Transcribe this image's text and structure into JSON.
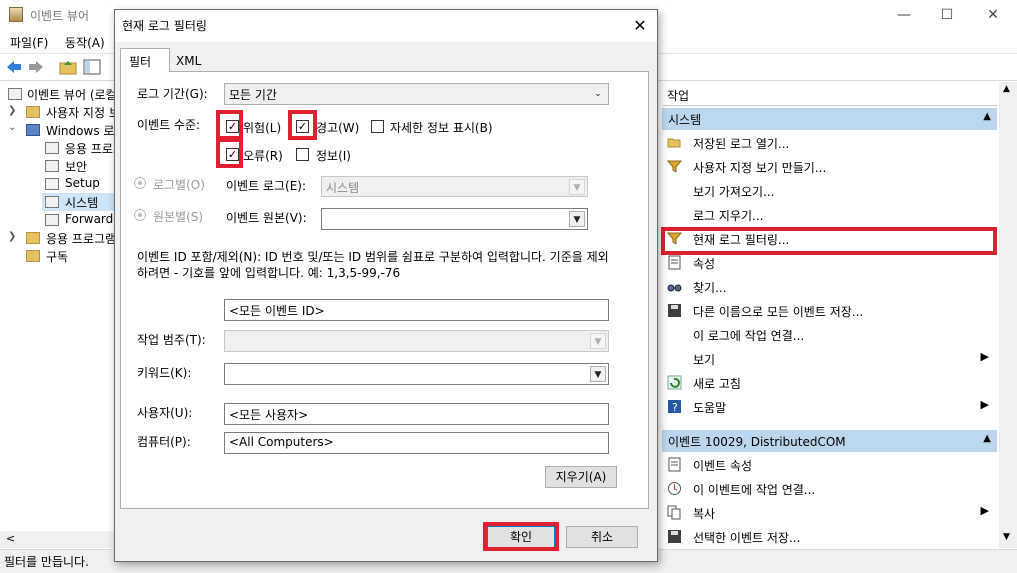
{
  "app": {
    "title": "이벤트 뷰어",
    "icon": "event-viewer-icon"
  },
  "window_controls": {
    "minimize": "—",
    "maximize": "☐",
    "close": "✕"
  },
  "menu": {
    "file": "파일(F)",
    "action": "동작(A)"
  },
  "tree": {
    "root": "이벤트 뷰어 (로컬)",
    "custom_views": "사용자 지정 보기",
    "windows_logs": "Windows 로그",
    "application": "응용 프로그램",
    "security": "보안",
    "setup": "Setup",
    "system": "시스템",
    "forwarded": "Forwarded Events",
    "apps_services": "응용 프로그램 및 서비스 로그",
    "subscriptions": "구독"
  },
  "status": {
    "text": "필터를 만듭니다."
  },
  "actions": {
    "title": "작업",
    "section1": "시스템",
    "items1": [
      {
        "label": "저장된 로그 열기...",
        "icon": "open-folder-icon"
      },
      {
        "label": "사용자 지정 보기 만들기...",
        "icon": "filter-icon"
      },
      {
        "label": "보기 가져오기...",
        "icon": ""
      },
      {
        "label": "로그 지우기...",
        "icon": ""
      },
      {
        "label": "현재 로그 필터링...",
        "icon": "filter-icon"
      },
      {
        "label": "속성",
        "icon": "properties-icon"
      },
      {
        "label": "찾기...",
        "icon": "find-icon"
      },
      {
        "label": "다른 이름으로 모든 이벤트 저장...",
        "icon": "save-icon"
      },
      {
        "label": "이 로그에 작업 연결...",
        "icon": ""
      },
      {
        "label": "보기",
        "icon": ""
      },
      {
        "label": "새로 고침",
        "icon": "refresh-icon"
      },
      {
        "label": "도움말",
        "icon": "help-icon"
      }
    ],
    "section2": "이벤트 10029, DistributedCOM",
    "items2": [
      {
        "label": "이벤트 속성",
        "icon": "properties-icon"
      },
      {
        "label": "이 이벤트에 작업 연결...",
        "icon": "task-icon"
      },
      {
        "label": "복사",
        "icon": "copy-icon"
      },
      {
        "label": "선택한 이벤트 저장...",
        "icon": "save-icon"
      }
    ]
  },
  "dialog": {
    "title": "현재 로그 필터링",
    "close": "✕",
    "tabs": {
      "filter": "필터",
      "xml": "XML"
    },
    "logged_label": "로그 기간(G):",
    "logged_value": "모든 기간",
    "level_label": "이벤트 수준:",
    "levels": {
      "critical": {
        "label": "위험(L)",
        "checked": true
      },
      "warning": {
        "label": "경고(W)",
        "checked": true
      },
      "verbose": {
        "label": "자세한 정보 표시(B)",
        "checked": false
      },
      "error": {
        "label": "오류(R)",
        "checked": true
      },
      "info": {
        "label": "정보(I)",
        "checked": false
      }
    },
    "by_log_label": "로그별(O)",
    "event_logs_label": "이벤트 로그(E):",
    "event_logs_value": "시스템",
    "by_source_label": "원본별(S)",
    "event_sources_label": "이벤트 원본(V):",
    "event_sources_value": "",
    "id_help": "이벤트 ID 포함/제외(N): ID 번호 및/또는 ID 범위를 쉼표로 구분하여 입력합니다. 기준을 제외하려면 - 기호를 앞에 입력합니다. 예: 1,3,5-99,-76",
    "id_value": "<모든 이벤트 ID>",
    "task_category_label": "작업 범주(T):",
    "task_category_value": "",
    "keywords_label": "키워드(K):",
    "keywords_value": "",
    "user_label": "사용자(U):",
    "user_value": "<모든 사용자>",
    "computer_label": "컴퓨터(P):",
    "computer_value": "<All Computers>",
    "clear_button": "지우기(A)",
    "ok_button": "확인",
    "cancel_button": "취소"
  },
  "colors": {
    "highlight": "#e0202e",
    "section_header": "#bcd6ee",
    "selection": "#cde5f7"
  }
}
